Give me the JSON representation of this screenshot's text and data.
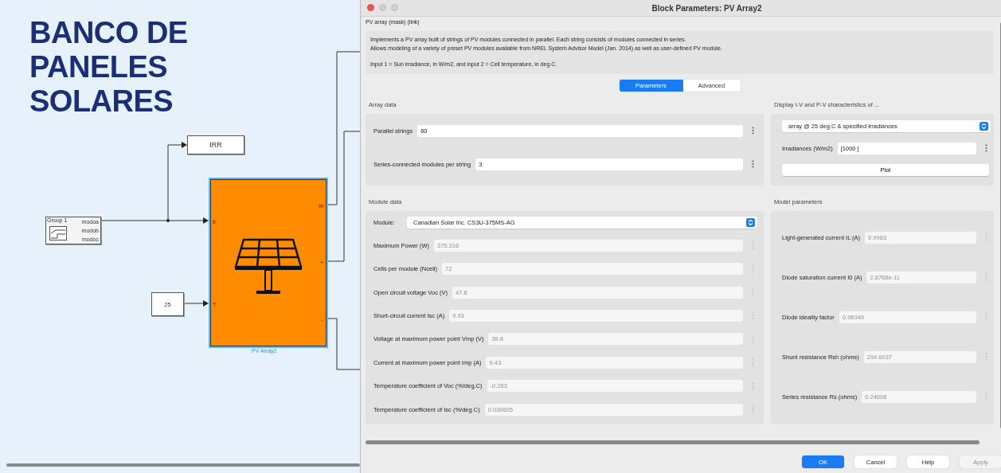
{
  "canvas": {
    "title_lines": [
      "BANCO DE",
      "PANELES",
      "SOLARES"
    ],
    "source_block": {
      "name": "Group 1",
      "outputs": [
        "modoa",
        "modob",
        "modoc"
      ]
    },
    "goto_block": {
      "label": "IRR"
    },
    "constant_block": {
      "value": "25"
    },
    "pv_block": {
      "name": "PV Array2",
      "inputs": [
        "Ir",
        "T"
      ],
      "outputs": [
        "m",
        "+",
        "-"
      ]
    }
  },
  "dialog": {
    "title": "Block Parameters: PV Array2",
    "mask_label": "PV array (mask) (link)",
    "description": [
      "Implements a PV array built of strings of PV modules connected in parallel. Each string consists of modules connected in series.",
      "Allows modeling of a variety of preset PV modules available from NREL System Advisor Model (Jan. 2014) as well as user-defined PV module.",
      "Input 1 = Sun irradiance, in W/m2, and input 2 = Cell temperature, in deg.C."
    ],
    "tabs": [
      {
        "label": "Parameters",
        "selected": true
      },
      {
        "label": "Advanced",
        "selected": false
      }
    ],
    "array_data": {
      "title": "Array data",
      "fields": [
        {
          "label": "Parallel strings",
          "value": "60",
          "disabled": false
        },
        {
          "label": "Series-connected modules per string",
          "value": "3",
          "disabled": false
        }
      ]
    },
    "module_data": {
      "title": "Module data",
      "module": {
        "label": "Module:",
        "value": "Canadian Solar Inc. CS3U-375MS-AG"
      },
      "fields": [
        {
          "label": "Maximum Power (W)",
          "value": "375.316",
          "disabled": true
        },
        {
          "label": "Cells per module (Ncell)",
          "value": "72",
          "disabled": true
        },
        {
          "label": "Open circuit voltage  Voc (V)",
          "value": "47.8",
          "disabled": true
        },
        {
          "label": "Short-circuit current Isc (A)",
          "value": "9.93",
          "disabled": true
        },
        {
          "label": "Voltage at maximum power point Vmp (V)",
          "value": "39.8",
          "disabled": true
        },
        {
          "label": "Current at maximum power point Imp (A)",
          "value": "9.43",
          "disabled": true
        },
        {
          "label": "Temperature coefficient of Voc (%/deg.C)",
          "value": "-0.283",
          "disabled": true
        },
        {
          "label": "Temperature coefficient of Isc (%/deg.C)",
          "value": "0.030605",
          "disabled": true
        }
      ]
    },
    "display": {
      "title": "Display  I-V and P-V characteristics of ...",
      "dropdown": "array @ 25 deg.C & specified irradiances",
      "irradiances": {
        "label": "Irradiances (W/m2)",
        "value": "[1000 ]",
        "disabled": false
      },
      "plot_button": "Plot"
    },
    "model_parameters": {
      "title": "Model parameters",
      "fields": [
        {
          "label": "Light-generated current IL (A)",
          "value": "9.9983",
          "disabled": true
        },
        {
          "label": "Diode saturation current I0 (A)",
          "value": "2.8766e-11",
          "disabled": true
        },
        {
          "label": "Diode ideality factor",
          "value": "0.96349",
          "disabled": true
        },
        {
          "label": "Shunt resistance Rsh (ohms)",
          "value": "294.0037",
          "disabled": true
        },
        {
          "label": "Series resistance Rs (ohms)",
          "value": "0.24008",
          "disabled": true
        }
      ]
    },
    "buttons": [
      {
        "label": "OK",
        "kind": "primary",
        "disabled": false
      },
      {
        "label": "Cancel",
        "kind": "normal",
        "disabled": false
      },
      {
        "label": "Help",
        "kind": "normal",
        "disabled": false
      },
      {
        "label": "Apply",
        "kind": "normal",
        "disabled": true
      }
    ]
  }
}
